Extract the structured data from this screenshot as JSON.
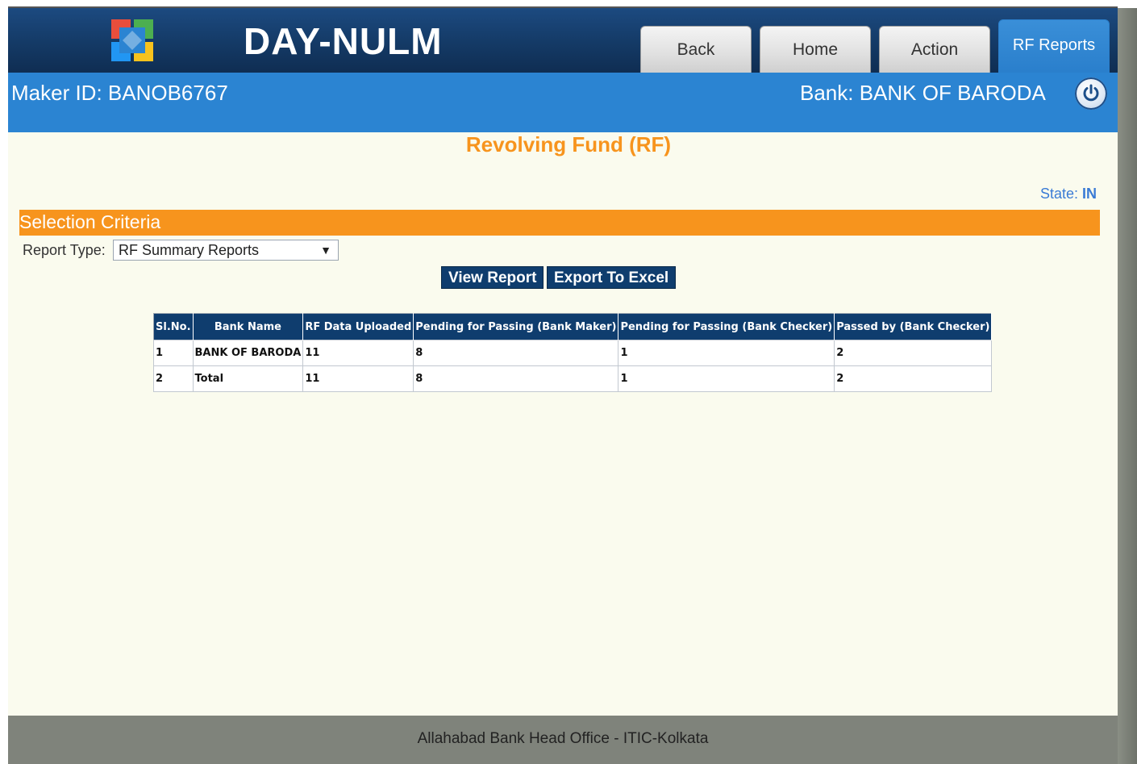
{
  "header": {
    "app_title": "DAY-NULM",
    "nav": [
      {
        "label": "Back"
      },
      {
        "label": "Home"
      },
      {
        "label": "Action"
      },
      {
        "label": "RF Reports"
      }
    ]
  },
  "subheader": {
    "maker_id": "Maker ID: BANOB6767",
    "bank": "Bank: BANK OF BARODA"
  },
  "page": {
    "title": "Revolving Fund (RF)",
    "state_label": "State:",
    "state_value": "IN"
  },
  "criteria": {
    "title": "Selection Criteria",
    "report_type_label": "Report Type:",
    "report_type_value": "RF Summary Reports",
    "view_report_label": "View Report",
    "export_label": "Export To Excel"
  },
  "table": {
    "headers": [
      "Sl.No.",
      "Bank Name",
      "RF Data Uploaded",
      "Pending for Passing (Bank Maker)",
      "Pending for Passing (Bank Checker)",
      "Passed by (Bank Checker)"
    ],
    "rows": [
      [
        "1",
        "BANK OF BARODA",
        "11",
        "8",
        "1",
        "2"
      ],
      [
        "2",
        "Total",
        "11",
        "8",
        "1",
        "2"
      ]
    ]
  },
  "footer": {
    "text": "Allahabad Bank Head Office - ITIC-Kolkata"
  },
  "colors": {
    "header_dark_blue": "#143a66",
    "subheader_blue": "#2b84d2",
    "orange": "#f7941d",
    "content_bg": "#fafbee",
    "footer_gray": "#7f837b"
  },
  "icons": {
    "logo": "day-nulm-logo",
    "power": "power-icon",
    "dropdown": "chevron-down-icon"
  }
}
